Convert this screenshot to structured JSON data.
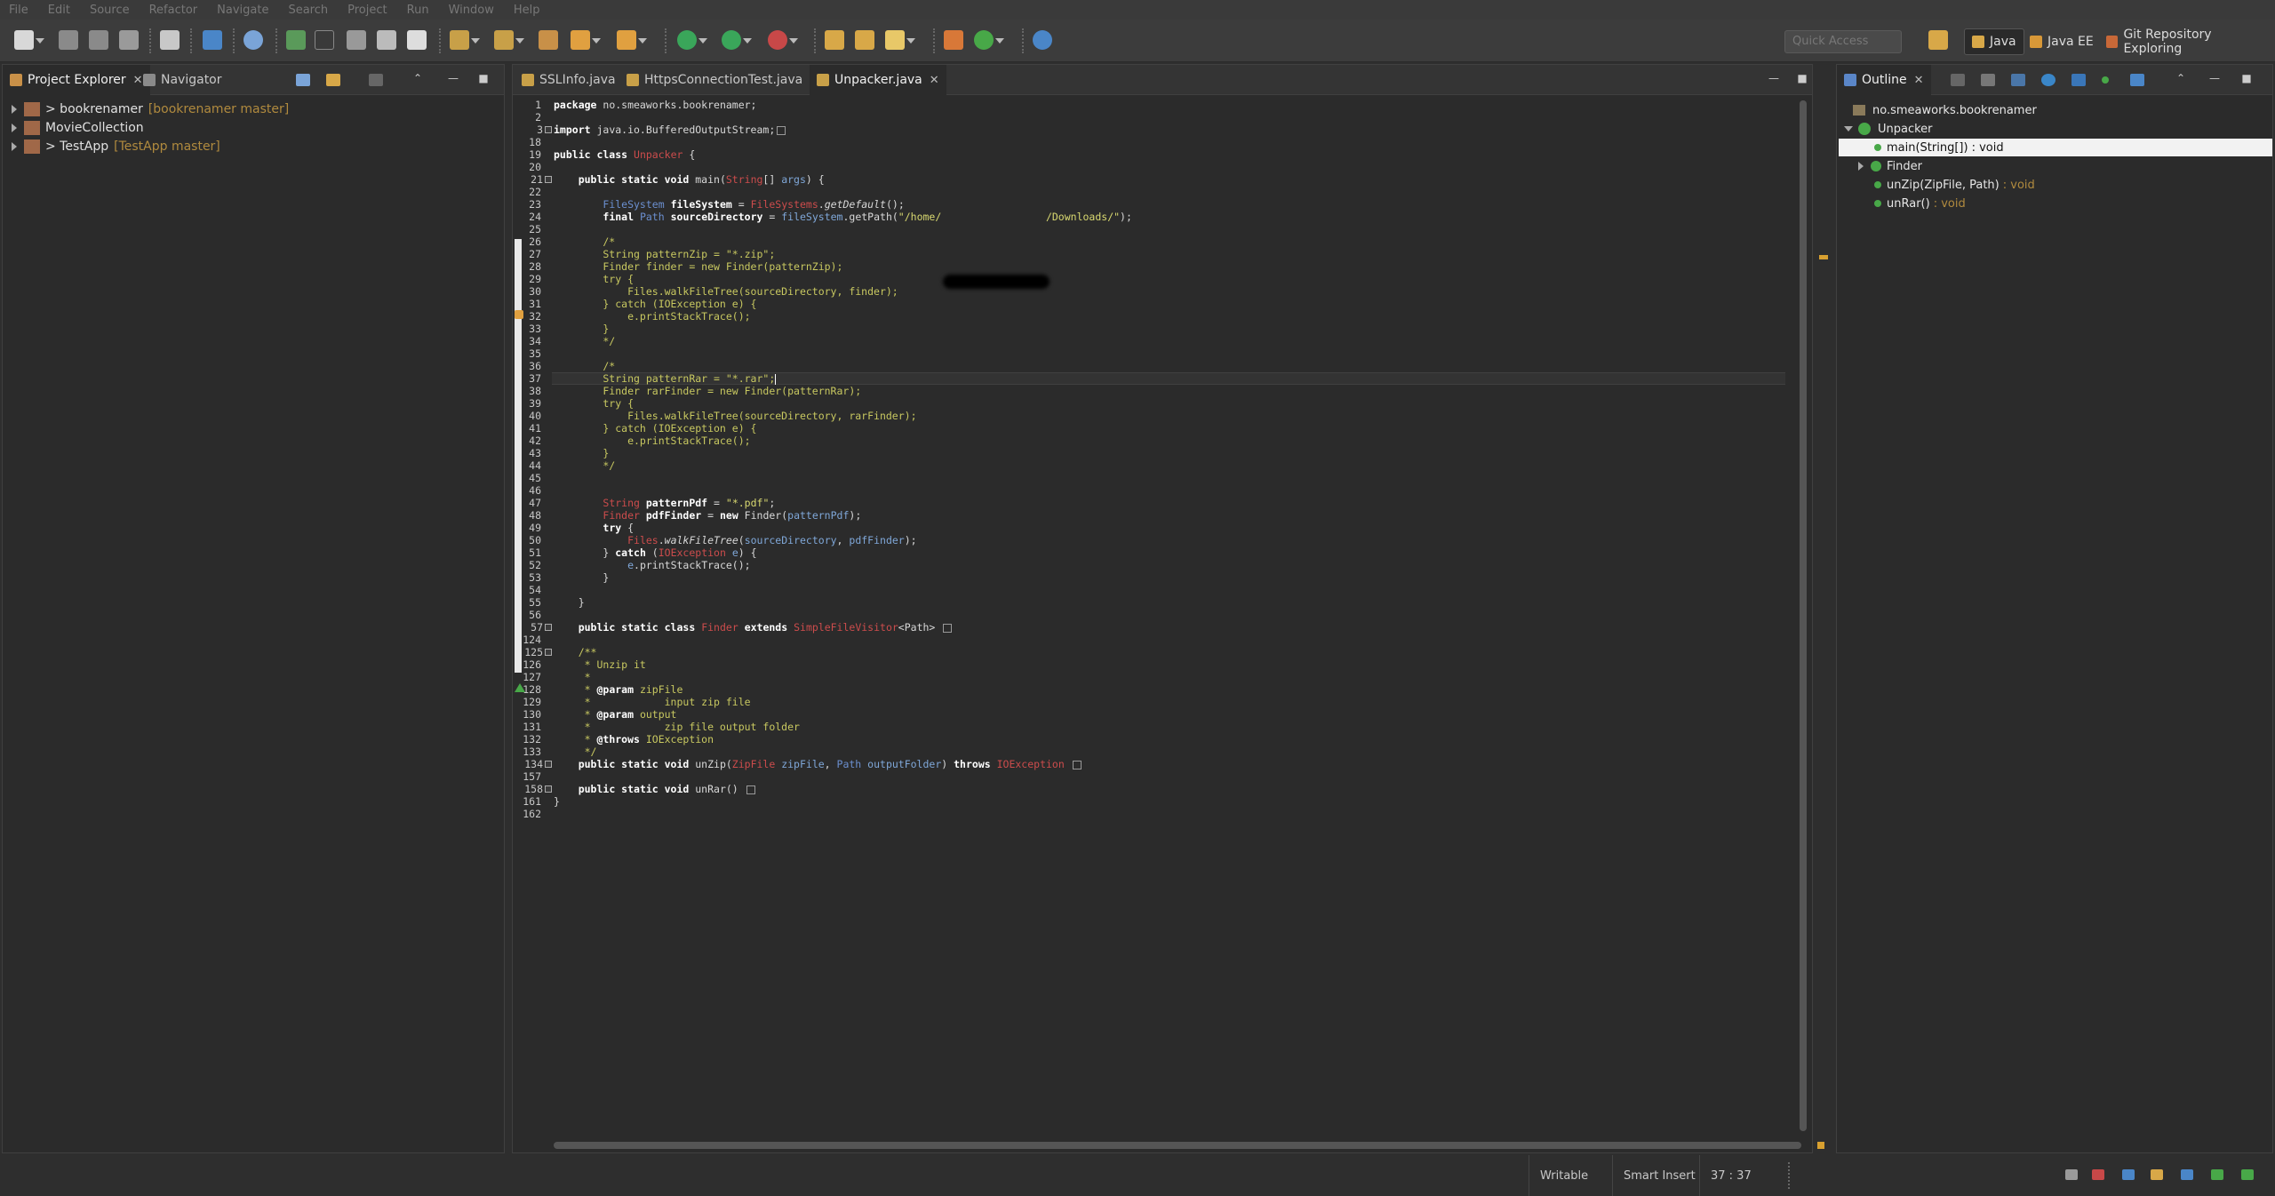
{
  "menu": [
    "File",
    "Edit",
    "Source",
    "Refactor",
    "Navigate",
    "Search",
    "Project",
    "Run",
    "Window",
    "Help"
  ],
  "toolbar": {
    "quick_access_placeholder": "Quick Access",
    "perspectives": [
      "Java",
      "Java EE",
      "Git Repository Exploring"
    ]
  },
  "left_panel": {
    "tabs": [
      "Project Explorer",
      "Navigator"
    ],
    "projects": [
      {
        "name": "> bookrenamer",
        "repo": "[bookrenamer master]"
      },
      {
        "name": "MovieCollection",
        "repo": ""
      },
      {
        "name": "> TestApp",
        "repo": "[TestApp master]"
      }
    ]
  },
  "editor": {
    "tabs": [
      "SSLInfo.java",
      "HttpsConnectionTest.java",
      "Unpacker.java"
    ],
    "active_tab": "Unpacker.java",
    "lines": [
      {
        "n": "1",
        "segs": [
          [
            "kw",
            "package"
          ],
          [
            "t",
            " no.smeaworks.bookrenamer;"
          ]
        ]
      },
      {
        "n": "2",
        "segs": []
      },
      {
        "n": "3",
        "segs": [
          [
            "kw",
            "import"
          ],
          [
            "t",
            " java.io.BufferedOutputStream;"
          ]
        ],
        "box": true
      },
      {
        "n": "18",
        "segs": []
      },
      {
        "n": "19",
        "segs": [
          [
            "kw",
            "public class"
          ],
          [
            "t",
            " "
          ],
          [
            "cls",
            "Unpacker"
          ],
          [
            "t",
            " {"
          ]
        ]
      },
      {
        "n": "20",
        "segs": []
      },
      {
        "n": "21",
        "segs": [
          [
            "t",
            "    "
          ],
          [
            "kw",
            "public static void"
          ],
          [
            "t",
            " main("
          ],
          [
            "cls",
            "String"
          ],
          [
            "t",
            "[] "
          ],
          [
            "var",
            "args"
          ],
          [
            "t",
            ") {"
          ]
        ]
      },
      {
        "n": "22",
        "segs": []
      },
      {
        "n": "23",
        "segs": [
          [
            "t",
            "        "
          ],
          [
            "typ",
            "FileSystem"
          ],
          [
            "t",
            " "
          ],
          [
            "kw",
            "fileSystem"
          ],
          [
            "t",
            " = "
          ],
          [
            "cls",
            "FileSystems"
          ],
          [
            "t",
            "."
          ],
          [
            "ital",
            "getDefault"
          ],
          [
            "t",
            "();"
          ]
        ]
      },
      {
        "n": "24",
        "segs": [
          [
            "t",
            "        "
          ],
          [
            "kw",
            "final"
          ],
          [
            "t",
            " "
          ],
          [
            "typ",
            "Path"
          ],
          [
            "t",
            " "
          ],
          [
            "kw",
            "sourceDirectory"
          ],
          [
            "t",
            " = "
          ],
          [
            "var",
            "fileSystem"
          ],
          [
            "t",
            ".getPath("
          ],
          [
            "str",
            "\"/home/                 /Downloads/\""
          ],
          [
            "t",
            ");"
          ]
        ]
      },
      {
        "n": "25",
        "segs": []
      },
      {
        "n": "26",
        "segs": [
          [
            "cmt",
            "        /*"
          ]
        ]
      },
      {
        "n": "27",
        "segs": [
          [
            "cmt",
            "        String patternZip = \"*.zip\";"
          ]
        ]
      },
      {
        "n": "28",
        "segs": [
          [
            "cmt",
            "        Finder finder = new Finder(patternZip);"
          ]
        ]
      },
      {
        "n": "29",
        "segs": [
          [
            "cmt",
            "        try {"
          ]
        ]
      },
      {
        "n": "30",
        "segs": [
          [
            "cmt",
            "            Files.walkFileTree(sourceDirectory, finder);"
          ]
        ]
      },
      {
        "n": "31",
        "segs": [
          [
            "cmt",
            "        } catch (IOException e) {"
          ]
        ]
      },
      {
        "n": "32",
        "segs": [
          [
            "cmt",
            "            e.printStackTrace();"
          ]
        ]
      },
      {
        "n": "33",
        "segs": [
          [
            "cmt",
            "        }"
          ]
        ]
      },
      {
        "n": "34",
        "segs": [
          [
            "cmt",
            "        */"
          ]
        ]
      },
      {
        "n": "35",
        "segs": []
      },
      {
        "n": "36",
        "segs": [
          [
            "cmt",
            "        /*"
          ]
        ]
      },
      {
        "n": "37",
        "segs": [
          [
            "cmt",
            "        String patternRar = \"*.rar\";"
          ]
        ],
        "caret": true
      },
      {
        "n": "38",
        "segs": [
          [
            "cmt",
            "        Finder rarFinder = new Finder(patternRar);"
          ]
        ]
      },
      {
        "n": "39",
        "segs": [
          [
            "cmt",
            "        try {"
          ]
        ]
      },
      {
        "n": "40",
        "segs": [
          [
            "cmt",
            "            Files.walkFileTree(sourceDirectory, rarFinder);"
          ]
        ]
      },
      {
        "n": "41",
        "segs": [
          [
            "cmt",
            "        } catch (IOException e) {"
          ]
        ]
      },
      {
        "n": "42",
        "segs": [
          [
            "cmt",
            "            e.printStackTrace();"
          ]
        ]
      },
      {
        "n": "43",
        "segs": [
          [
            "cmt",
            "        }"
          ]
        ]
      },
      {
        "n": "44",
        "segs": [
          [
            "cmt",
            "        */"
          ]
        ]
      },
      {
        "n": "45",
        "segs": []
      },
      {
        "n": "46",
        "segs": []
      },
      {
        "n": "47",
        "segs": [
          [
            "t",
            "        "
          ],
          [
            "cls",
            "String"
          ],
          [
            "t",
            " "
          ],
          [
            "kw",
            "patternPdf"
          ],
          [
            "t",
            " = "
          ],
          [
            "str",
            "\"*.pdf\""
          ],
          [
            "t",
            ";"
          ]
        ]
      },
      {
        "n": "48",
        "segs": [
          [
            "t",
            "        "
          ],
          [
            "cls",
            "Finder"
          ],
          [
            "t",
            " "
          ],
          [
            "kw",
            "pdfFinder"
          ],
          [
            "t",
            " = "
          ],
          [
            "kw",
            "new"
          ],
          [
            "t",
            " Finder("
          ],
          [
            "var",
            "patternPdf"
          ],
          [
            "t",
            ");"
          ]
        ]
      },
      {
        "n": "49",
        "segs": [
          [
            "t",
            "        "
          ],
          [
            "kw",
            "try"
          ],
          [
            "t",
            " {"
          ]
        ]
      },
      {
        "n": "50",
        "segs": [
          [
            "t",
            "            "
          ],
          [
            "cls",
            "Files"
          ],
          [
            "t",
            "."
          ],
          [
            "ital",
            "walkFileTree"
          ],
          [
            "t",
            "("
          ],
          [
            "var",
            "sourceDirectory"
          ],
          [
            "t",
            ", "
          ],
          [
            "var",
            "pdfFinder"
          ],
          [
            "t",
            ");"
          ]
        ]
      },
      {
        "n": "51",
        "segs": [
          [
            "t",
            "        } "
          ],
          [
            "kw",
            "catch"
          ],
          [
            "t",
            " ("
          ],
          [
            "cls",
            "IOException"
          ],
          [
            "t",
            " "
          ],
          [
            "var",
            "e"
          ],
          [
            "t",
            ") {"
          ]
        ]
      },
      {
        "n": "52",
        "segs": [
          [
            "t",
            "            "
          ],
          [
            "var",
            "e"
          ],
          [
            "t",
            ".printStackTrace();"
          ]
        ]
      },
      {
        "n": "53",
        "segs": [
          [
            "t",
            "        }"
          ]
        ]
      },
      {
        "n": "54",
        "segs": []
      },
      {
        "n": "55",
        "segs": [
          [
            "t",
            "    }"
          ]
        ]
      },
      {
        "n": "56",
        "segs": []
      },
      {
        "n": "57",
        "segs": [
          [
            "t",
            "    "
          ],
          [
            "kw",
            "public static class"
          ],
          [
            "t",
            " "
          ],
          [
            "cls",
            "Finder"
          ],
          [
            "t",
            " "
          ],
          [
            "kw",
            "extends"
          ],
          [
            "t",
            " "
          ],
          [
            "cls",
            "SimpleFileVisitor"
          ],
          [
            "t",
            "<Path> "
          ]
        ],
        "box": true
      },
      {
        "n": "124",
        "segs": []
      },
      {
        "n": "125",
        "segs": [
          [
            "cmt",
            "    /**"
          ]
        ]
      },
      {
        "n": "126",
        "segs": [
          [
            "cmt",
            "     * Unzip it"
          ]
        ]
      },
      {
        "n": "127",
        "segs": [
          [
            "cmt",
            "     *"
          ]
        ]
      },
      {
        "n": "128",
        "segs": [
          [
            "cmt",
            "     * "
          ],
          [
            "kw",
            "@param"
          ],
          [
            "cmt",
            " zipFile"
          ]
        ]
      },
      {
        "n": "129",
        "segs": [
          [
            "cmt",
            "     *            input zip file"
          ]
        ]
      },
      {
        "n": "130",
        "segs": [
          [
            "cmt",
            "     * "
          ],
          [
            "kw",
            "@param"
          ],
          [
            "cmt",
            " output"
          ]
        ]
      },
      {
        "n": "131",
        "segs": [
          [
            "cmt",
            "     *            zip file output folder"
          ]
        ]
      },
      {
        "n": "132",
        "segs": [
          [
            "cmt",
            "     * "
          ],
          [
            "kw",
            "@throws"
          ],
          [
            "cmt",
            " IOException"
          ]
        ]
      },
      {
        "n": "133",
        "segs": [
          [
            "cmt",
            "     */"
          ]
        ]
      },
      {
        "n": "134",
        "segs": [
          [
            "t",
            "    "
          ],
          [
            "kw",
            "public static void"
          ],
          [
            "t",
            " unZip("
          ],
          [
            "cls",
            "ZipFile"
          ],
          [
            "t",
            " "
          ],
          [
            "var",
            "zipFile"
          ],
          [
            "t",
            ", "
          ],
          [
            "typ",
            "Path"
          ],
          [
            "t",
            " "
          ],
          [
            "var",
            "outputFolder"
          ],
          [
            "t",
            ") "
          ],
          [
            "kw",
            "throws"
          ],
          [
            "t",
            " "
          ],
          [
            "cls",
            "IOException"
          ],
          [
            "t",
            " "
          ]
        ],
        "box": true
      },
      {
        "n": "157",
        "segs": []
      },
      {
        "n": "158",
        "segs": [
          [
            "t",
            "    "
          ],
          [
            "kw",
            "public static void"
          ],
          [
            "t",
            " unRar() "
          ]
        ],
        "box": true
      },
      {
        "n": "161",
        "segs": [
          [
            "t",
            "}"
          ]
        ]
      },
      {
        "n": "162",
        "segs": []
      }
    ]
  },
  "outline": {
    "tab": "Outline",
    "package": "no.smeaworks.bookrenamer",
    "class": "Unpacker",
    "members": [
      {
        "name": "main(String[])",
        "ret": ": void",
        "selected": true
      },
      {
        "name": "Finder",
        "ret": ""
      },
      {
        "name": "unZip(ZipFile, Path)",
        "ret": ": void"
      },
      {
        "name": "unRar()",
        "ret": ": void"
      }
    ]
  },
  "status": {
    "writable": "Writable",
    "insert_mode": "Smart Insert",
    "position": "37 : 37"
  },
  "colors": {
    "keyword": "#ffffff",
    "class": "#cc4c4c",
    "string": "#d8d870",
    "comment": "#c8c860",
    "repo": "#b08a3e"
  }
}
